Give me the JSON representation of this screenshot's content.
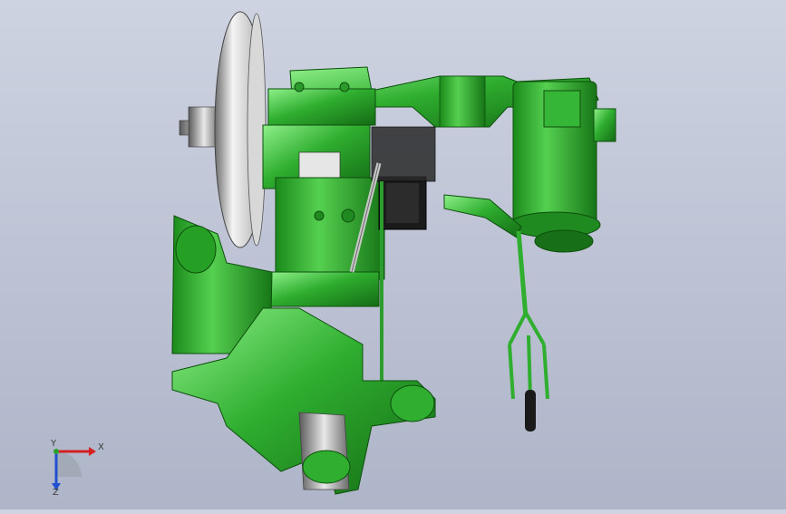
{
  "scene": {
    "background_top": "#cdd3e0",
    "background_bottom": "#aeb5c8",
    "part_color": "#2fae2f",
    "part_shade": "#1f7f1f",
    "part_highlight": "#7fe07a"
  },
  "triad": {
    "x_label": "X",
    "y_label": "Y",
    "z_label": "Z"
  }
}
